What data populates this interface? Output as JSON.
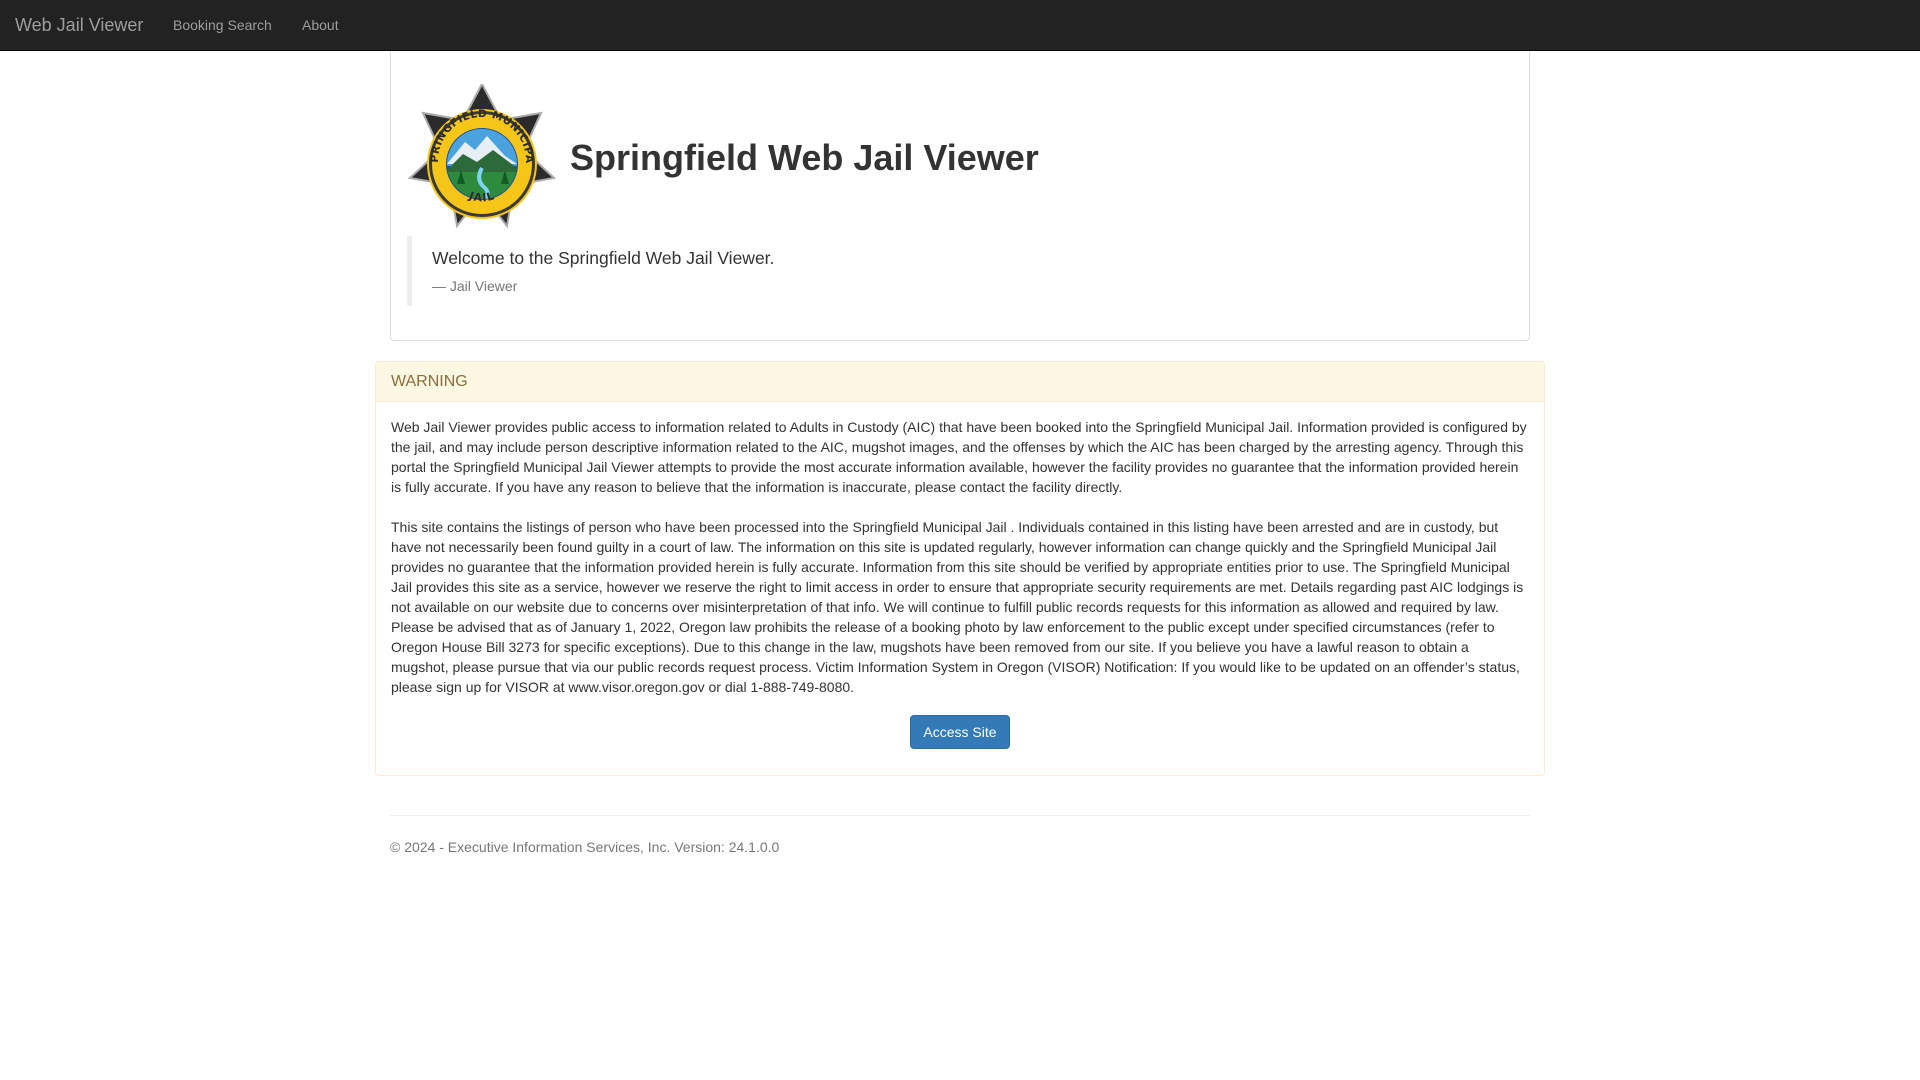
{
  "navbar": {
    "brand": "Web Jail Viewer",
    "links": [
      {
        "label": "Booking Search"
      },
      {
        "label": "About"
      }
    ]
  },
  "header": {
    "seal": {
      "top_text": "SPRINGFIELD MUNICIPAL",
      "bottom_text": "JAIL"
    },
    "title": "Springfield Web Jail Viewer",
    "quote": "Welcome to the Springfield Web Jail Viewer.",
    "quote_source": "— Jail Viewer"
  },
  "warning": {
    "heading": "WARNING",
    "paragraphs": [
      "Web Jail Viewer provides public access to information related to Adults in Custody (AIC) that have been booked into the Springfield Municipal Jail. Information provided is configured by the jail, and may include person descriptive information related to the AIC, mugshot images, and the offenses by which the AIC has been charged by the arresting agency. Through this portal the Springfield Municipal Jail Viewer attempts to provide the most accurate information available, however the facility provides no guarantee that the information provided herein is fully accurate. If you have any reason to believe that the information is inaccurate, please contact the facility directly.",
      "This site contains the listings of person who have been processed into the Springfield Municipal Jail . Individuals contained in this listing have been arrested and are in custody, but have not necessarily been found guilty in a court of law. The information on this site is updated regularly, however information can change quickly and the Springfield Municipal Jail provides no guarantee that the information provided herein is fully accurate. Information from this site should be verified by appropriate entities prior to use. The Springfield Municipal Jail provides this site as a service, however we reserve the right to limit access in order to ensure that appropriate security requirements are met. Details regarding past AIC lodgings is not available on our website due to concerns over misinterpretation of that info. We will continue to fulfill public records requests for this information as allowed and required by law. Please be advised that as of January 1, 2022, Oregon law prohibits the release of a booking photo by law enforcement to the public except under specified circumstances (refer to Oregon House Bill 3273 for specific exceptions). Due to this change in the law, mugshots have been removed from our site. If you believe you have a lawful reason to obtain a mugshot, please pursue that via our public records request process. Victim Information System in Oregon (VISOR) Notification: If you would like to be updated on an offender’s status, please sign up for VISOR at www.visor.oregon.gov or dial 1-888-749-8080."
    ],
    "button_label": "Access Site"
  },
  "footer": {
    "text": "© 2024 - Executive Information Services, Inc. Version: 24.1.0.0"
  },
  "colors": {
    "navbar_bg": "#222222",
    "warning_bg": "#fcf8e3",
    "warning_text": "#8a6d3b",
    "primary_button": "#337ab7",
    "seal_yellow": "#f5c518",
    "seal_dark": "#2b2b2b"
  }
}
